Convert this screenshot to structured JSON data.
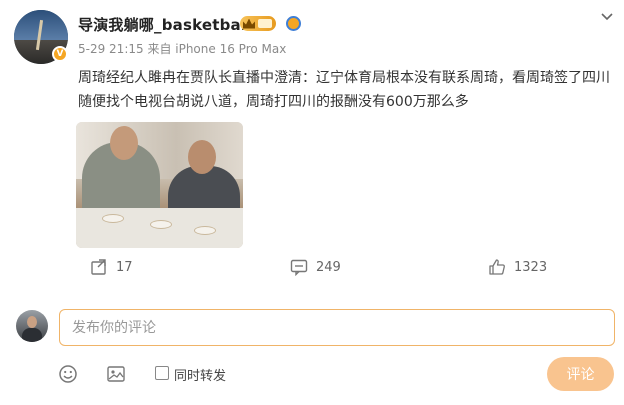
{
  "post": {
    "username": "导演我躺哪_basketball",
    "meta": "5-29 21:15 来自 iPhone 16 Pro Max",
    "text": "周琦经纪人雎冉在贾队长直播中澄清：辽宁体育局根本没有联系周琦，看周琦签了四川随便找个电视台胡说八道，周琦打四川的报酬没有600万那么多"
  },
  "actions": {
    "repost_count": "17",
    "comment_count": "249",
    "like_count": "1323"
  },
  "comment_box": {
    "placeholder": "发布你的评论",
    "repost_label": "同时转发",
    "submit_label": "评论"
  },
  "colors": {
    "accent": "#f0b468",
    "submit_bg": "#f9c48f",
    "vip": "#e79a1e"
  },
  "icons": [
    "chevron-down-icon",
    "repost-icon",
    "comment-icon",
    "like-icon",
    "emoji-icon",
    "image-icon",
    "verified-icon",
    "vip-crown-icon"
  ]
}
